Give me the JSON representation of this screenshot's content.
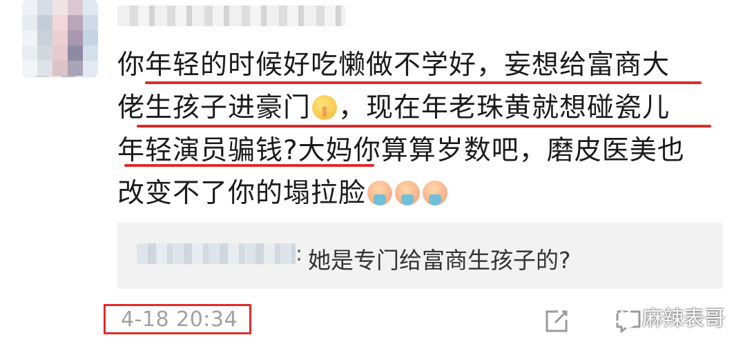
{
  "comment": {
    "lines": [
      "你年轻的时候好吃懒做不学好，妄想给富商大",
      "佬生孩子进豪门",
      "，现在年老珠黄就想碰瓷儿",
      "年轻演员骗钱?大妈你算算岁数吧，磨皮医美也",
      "改变不了你的塌拉脸"
    ],
    "emoji_1": "shushing-face",
    "emoji_2": "face-vomiting"
  },
  "reply": {
    "colon": ":",
    "text": "她是专门给富商生孩子的?"
  },
  "footer": {
    "timestamp": "4-18 20:34",
    "watermark": "麻辣表哥"
  },
  "icons": {
    "edit": "edit-icon",
    "comment": "comment-icon",
    "wechat": "wechat-icon"
  },
  "colors": {
    "highlight": "#e02a2a",
    "text": "#1a1a1a",
    "timestamp": "#a0a0a0",
    "reply_bg": "#f2f2f2"
  }
}
